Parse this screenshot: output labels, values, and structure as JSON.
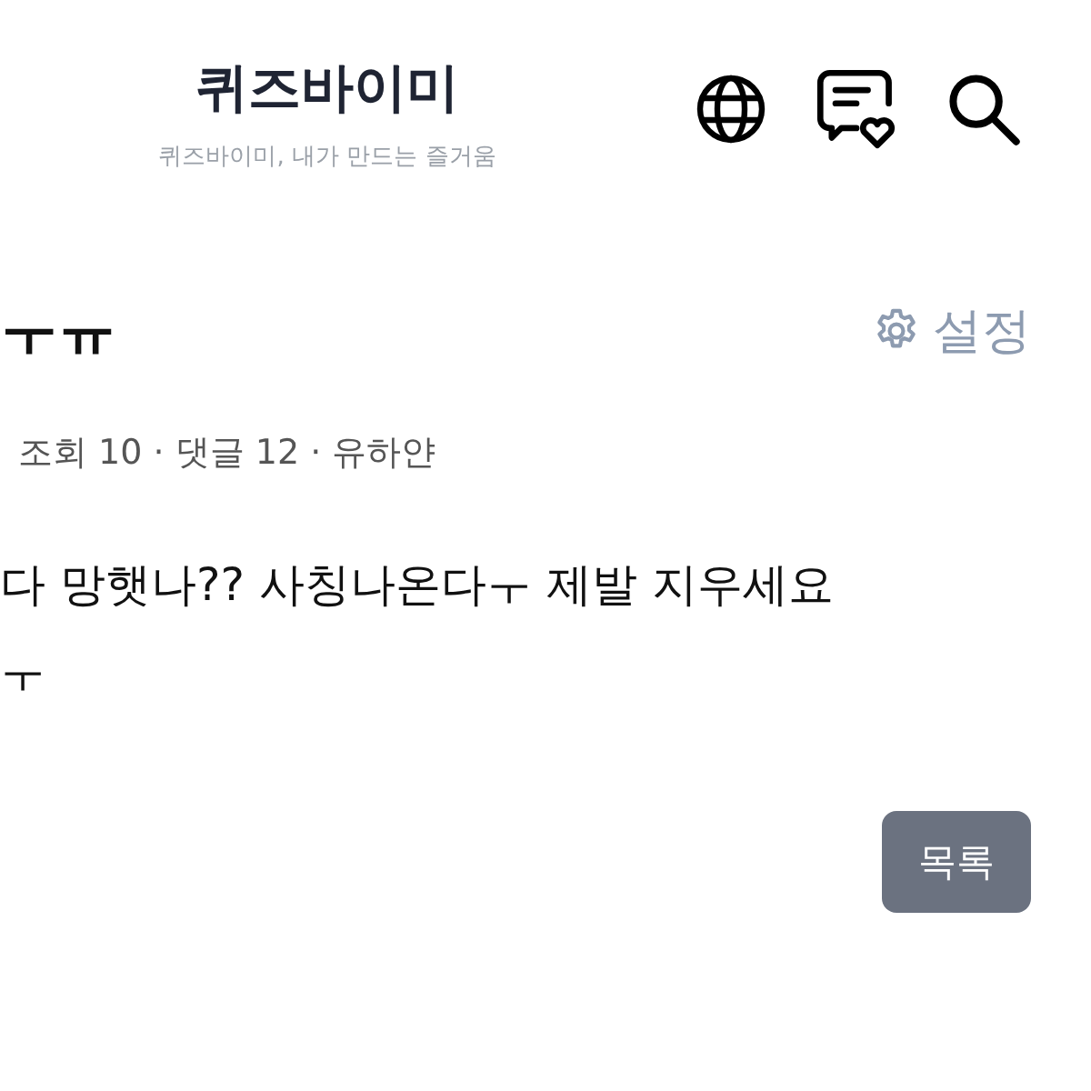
{
  "header": {
    "logo": "퀴즈바이미",
    "tagline": "퀴즈바이미, 내가 만드는 즐거움"
  },
  "post": {
    "title": "ㅜㅠ",
    "settings_label": "설정",
    "meta": "조회 10 · 댓글 12 · 유하얀",
    "body": [
      "다 망햇나?? 사칭나온다ㅜ 제발 지우세요",
      "ㅜ"
    ]
  },
  "list_button": "목록"
}
